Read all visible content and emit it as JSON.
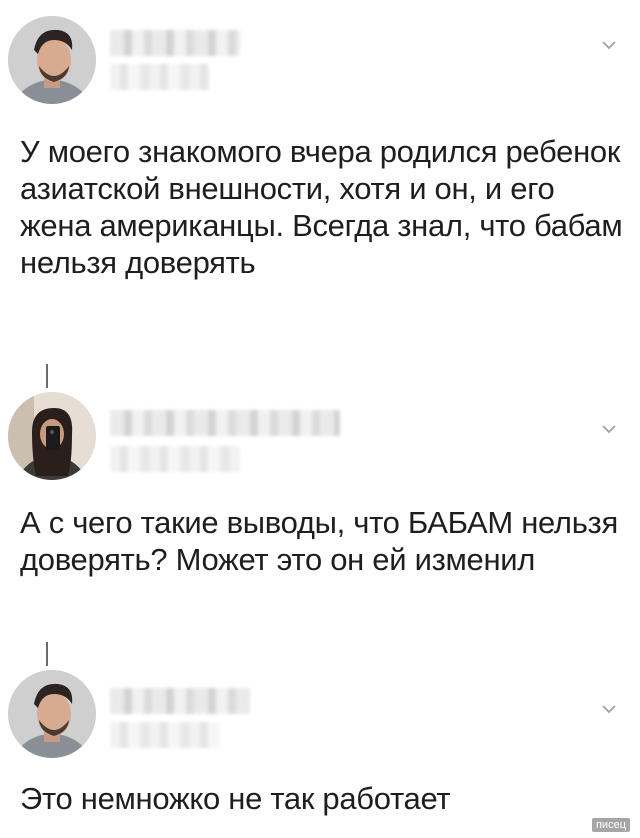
{
  "posts": [
    {
      "text": "У моего знакомого вчера родился ребенок азиатской внешности, хотя и он, и его жена американцы. Всегда знал, что бабам нельзя доверять"
    },
    {
      "text": "А с чего такие выводы, что БАБАМ нельзя доверять? Может это он ей изменил"
    },
    {
      "text": "Это немножко не так работает"
    }
  ],
  "watermark": "писец",
  "icons": {
    "chevron": "chevron-down-icon",
    "thread": "thread-connector"
  },
  "colors": {
    "text": "#1e1e1e",
    "chevron": "#9aa4ad",
    "background": "#ffffff"
  }
}
